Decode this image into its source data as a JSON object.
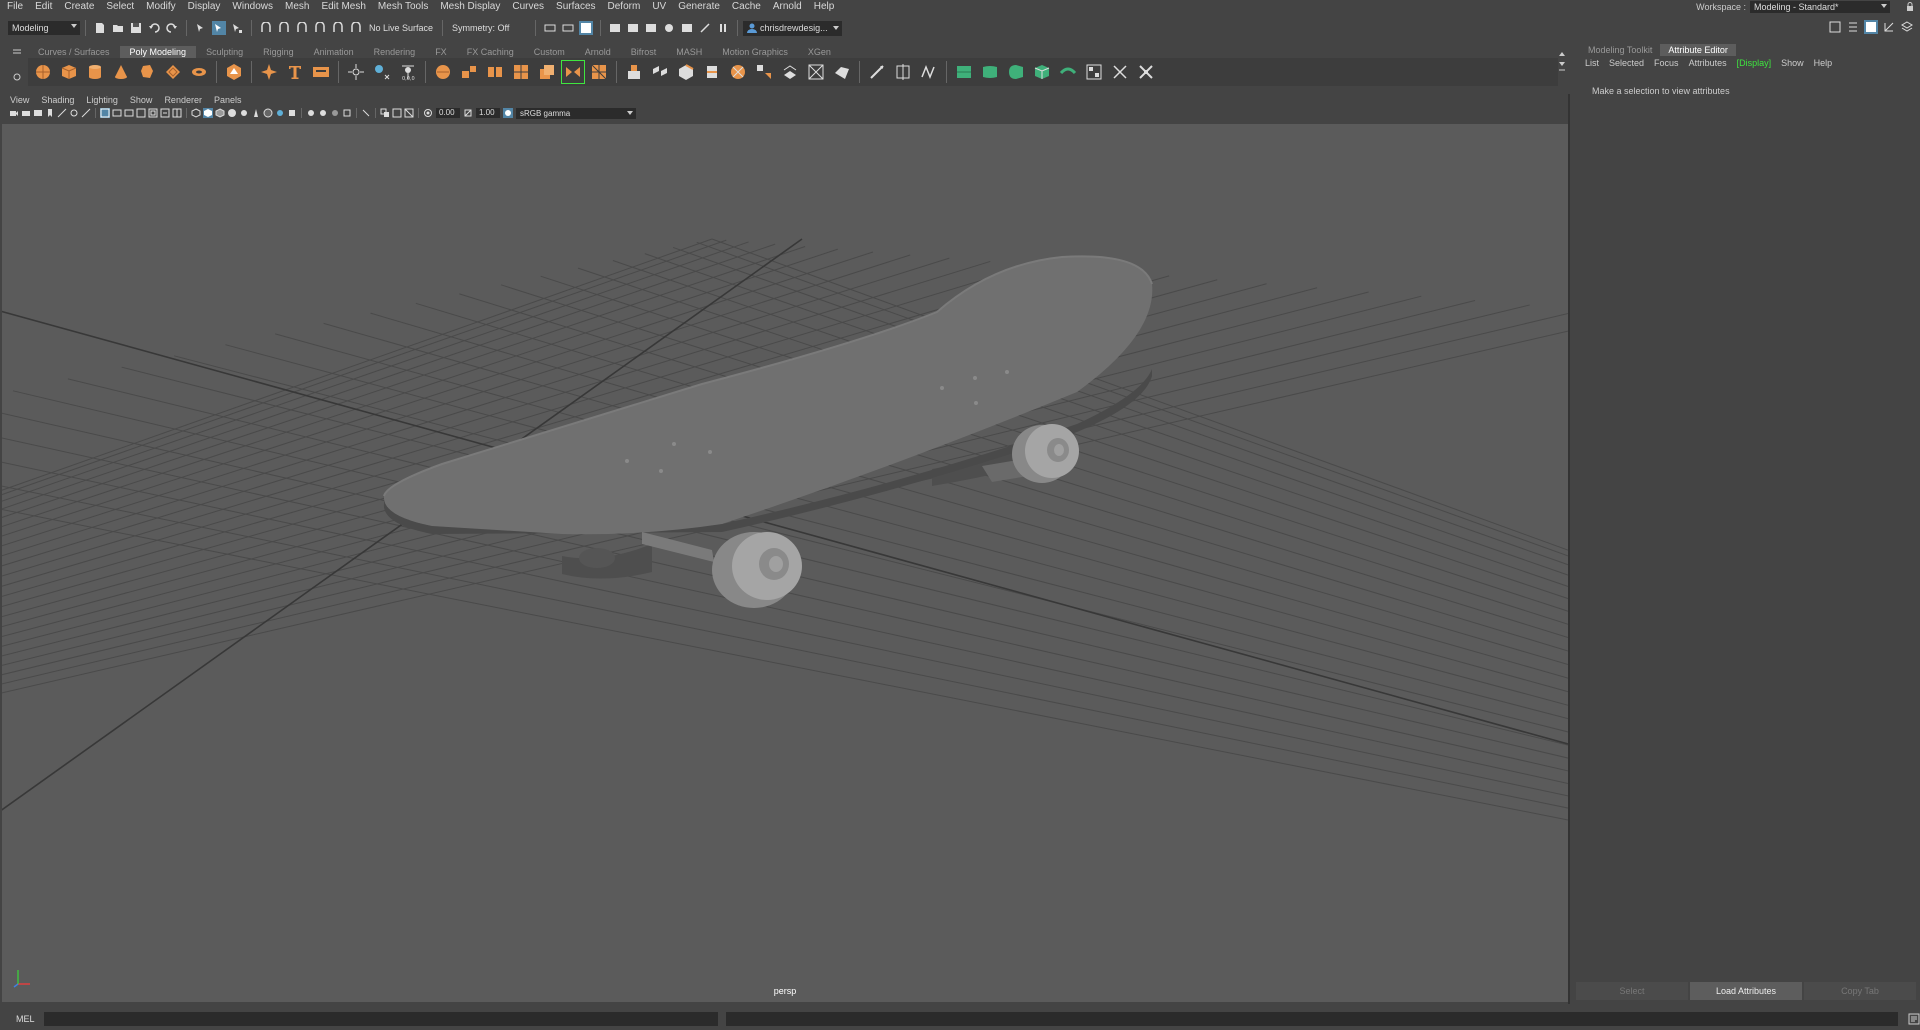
{
  "menubar": {
    "items": [
      "File",
      "Edit",
      "Create",
      "Select",
      "Modify",
      "Display",
      "Windows",
      "Mesh",
      "Edit Mesh",
      "Mesh Tools",
      "Mesh Display",
      "Curves",
      "Surfaces",
      "Deform",
      "UV",
      "Generate",
      "Cache",
      "Arnold",
      "Help"
    ],
    "workspace_label": "Workspace :",
    "workspace_value": "Modeling - Standard*"
  },
  "statusline": {
    "menuset": "Modeling",
    "live_surface": "No Live Surface",
    "symmetry": "Symmetry: Off",
    "user": "chrisdrewdesig..."
  },
  "shelf": {
    "tabs": [
      "Curves / Surfaces",
      "Poly Modeling",
      "Sculpting",
      "Rigging",
      "Animation",
      "Rendering",
      "FX",
      "FX Caching",
      "Custom",
      "Arnold",
      "Bifrost",
      "MASH",
      "Motion Graphics",
      "XGen"
    ],
    "active_tab": "Poly Modeling",
    "icons": [
      "sphere-icon",
      "cube-icon",
      "cylinder-icon",
      "cone-icon",
      "torus-icon",
      "plane-icon",
      "disc-icon",
      "platonic-icon",
      "star-icon",
      "type-icon",
      "svg-icon",
      "combine-icon",
      "separate-icon",
      "smooth-icon",
      "mirror-icon",
      "bridge-icon",
      "bevel-icon",
      "extrude-icon",
      "merge-icon",
      "fill-hole-icon",
      "append-icon",
      "multicut-icon",
      "target-weld-icon",
      "sculpt-icon",
      "quad-draw-icon",
      "uv-unfold-icon",
      "layout-icon"
    ],
    "accent": "#e8944a"
  },
  "viewport": {
    "panel_menu": [
      "View",
      "Shading",
      "Lighting",
      "Show",
      "Renderer",
      "Panels"
    ],
    "exposure": "0.00",
    "gamma": "1.00",
    "color_space": "sRGB gamma",
    "camera": "persp",
    "background": "#5b5b5b"
  },
  "attr_panel": {
    "tabs": [
      "Modeling Toolkit",
      "Attribute Editor"
    ],
    "active_tab": "Attribute Editor",
    "menu": [
      "List",
      "Selected",
      "Focus",
      "Attributes",
      "[Display]",
      "Show",
      "Help"
    ],
    "highlighted": "[Display]",
    "highlight_color": "#3fe63f",
    "message": "Make a selection to view attributes",
    "buttons": [
      "Select",
      "Load Attributes",
      "Copy Tab"
    ]
  },
  "cmdline": {
    "label": "MEL"
  }
}
